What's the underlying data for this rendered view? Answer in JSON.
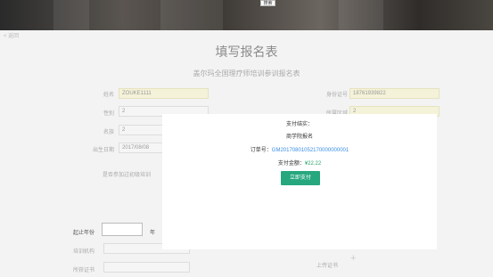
{
  "banner": {
    "search_label": "搜索"
  },
  "back_label": "< 返回",
  "page_title": "填写报名表",
  "form_title": "盖尔玛全国理疗师培训参训报名表",
  "fields": {
    "name": {
      "label": "姓名",
      "value": "ZOUKE1111"
    },
    "id_card": {
      "label": "身份证号",
      "value": "18761939822"
    },
    "gender": {
      "label": "性别",
      "value": "2"
    },
    "region": {
      "label": "所属区域",
      "value": "2"
    },
    "ethnicity": {
      "label": "名族",
      "value": "2"
    },
    "birth": {
      "label": "出生日期",
      "value": "2017/08/08"
    }
  },
  "attended_label": "是否参加过初级培训",
  "start_year_label": "起止年份",
  "year_label": "年",
  "org_label": "培训机构",
  "cert_label": "所获证书",
  "upload_label": "上传证书",
  "upload_plus": "+",
  "modal": {
    "line1": "支付结实：",
    "line2": "商学院报名",
    "order_label": "订单号：",
    "order_number": "GM20170801052170000000001",
    "amount_label": "支付金额：",
    "amount_value": "¥22.22",
    "pay_button": "立即支付"
  },
  "colors": {
    "accent": "#26a77e",
    "link": "#3a8ee6",
    "field_highlight": "#f4f2d8"
  }
}
